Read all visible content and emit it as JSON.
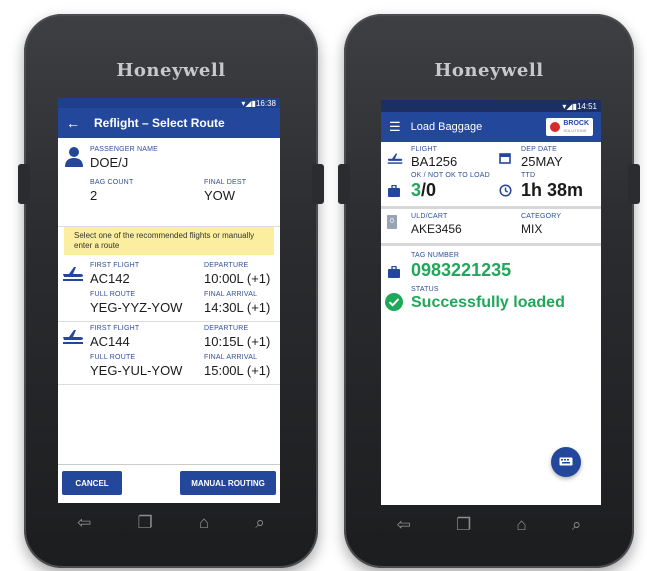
{
  "left": {
    "brand": "Honeywell",
    "status_time": "16:38",
    "app_title": "Reflight – Select Route",
    "passenger": {
      "name_label": "PASSENGER NAME",
      "name": "DOE/J",
      "bag_count_label": "BAG COUNT",
      "bag_count": "2",
      "final_dest_label": "FINAL DEST",
      "final_dest": "YOW"
    },
    "notice": "Select one of the recommended flights or manually enter a route",
    "flights": [
      {
        "first_flight_label": "FIRST FLIGHT",
        "first_flight": "AC142",
        "departure_label": "DEPARTURE",
        "departure": "10:00L (+1)",
        "route_label": "FULL ROUTE",
        "route": "YEG-YYZ-YOW",
        "arrival_label": "FINAL ARRIVAL",
        "arrival": "14:30L (+1)"
      },
      {
        "first_flight_label": "FIRST FLIGHT",
        "first_flight": "AC144",
        "departure_label": "DEPARTURE",
        "departure": "10:15L (+1)",
        "route_label": "FULL ROUTE",
        "route": "YEG-YUL-YOW",
        "arrival_label": "FINAL ARRIVAL",
        "arrival": "15:00L (+1)"
      }
    ],
    "cancel_label": "CANCEL",
    "manual_label": "MANUAL ROUTING"
  },
  "right": {
    "brand": "Honeywell",
    "status_time": "14:51",
    "app_title": "Load Baggage",
    "logo_text": "BROCK",
    "logo_sub": "SOLUTIONS",
    "flight_label": "FLIGHT",
    "flight": "BA1256",
    "dep_date_label": "DEP DATE",
    "dep_date": "25MAY",
    "ok_label": "OK / NOT OK TO LOAD",
    "ok_value": "3",
    "notok_value": "/0",
    "ttd_label": "TTD",
    "ttd": "1h 38m",
    "uld_badge": "0",
    "uld_label": "ULD/CART",
    "uld": "AKE3456",
    "category_label": "CATEGORY",
    "category": "MIX",
    "tag_label": "TAG NUMBER",
    "tag": "0983221235",
    "status_label": "STATUS",
    "status": "Successfully loaded"
  },
  "colors": {
    "primary": "#23489b",
    "success": "#1fa85a",
    "notice_bg": "#fbef9f"
  },
  "icons": [
    "back-arrow-icon",
    "person-icon",
    "plane-icon",
    "menu-icon",
    "calendar-icon",
    "suitcase-icon",
    "clock-icon",
    "check-circle-icon",
    "keyboard-icon",
    "nav-back-icon",
    "nav-recent-icon",
    "nav-home-icon",
    "nav-search-icon"
  ]
}
